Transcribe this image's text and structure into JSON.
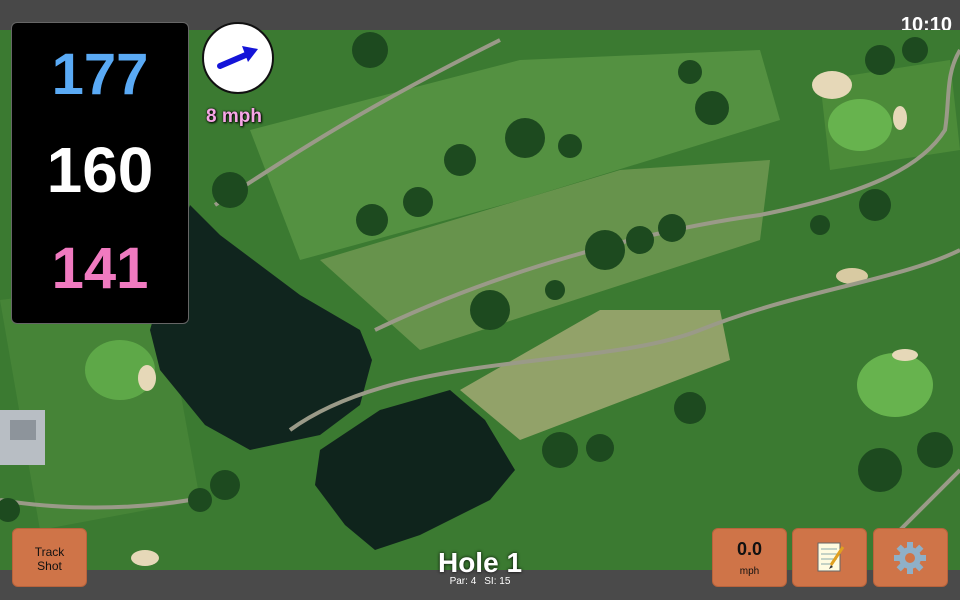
{
  "status": {
    "clock": "10:10"
  },
  "yardage": {
    "back": "177",
    "middle": "160",
    "front": "141"
  },
  "wind": {
    "speed": "8 mph",
    "direction_icon": "arrow-icon",
    "arrow_color": "#1414d8"
  },
  "hole": {
    "title": "Hole 1",
    "par": "Par: 4",
    "stroke_index": "SI: 15"
  },
  "buttons": {
    "track_shot": "Track\nShot",
    "speed_value": "0.0",
    "speed_unit": "mph",
    "notes_icon": "notepad-icon",
    "settings_icon": "gear-icon"
  },
  "colors": {
    "back_yardage": "#5aaaf5",
    "middle_yardage": "#ffffff",
    "front_yardage": "#f07ac0",
    "button": "#cf7448"
  }
}
